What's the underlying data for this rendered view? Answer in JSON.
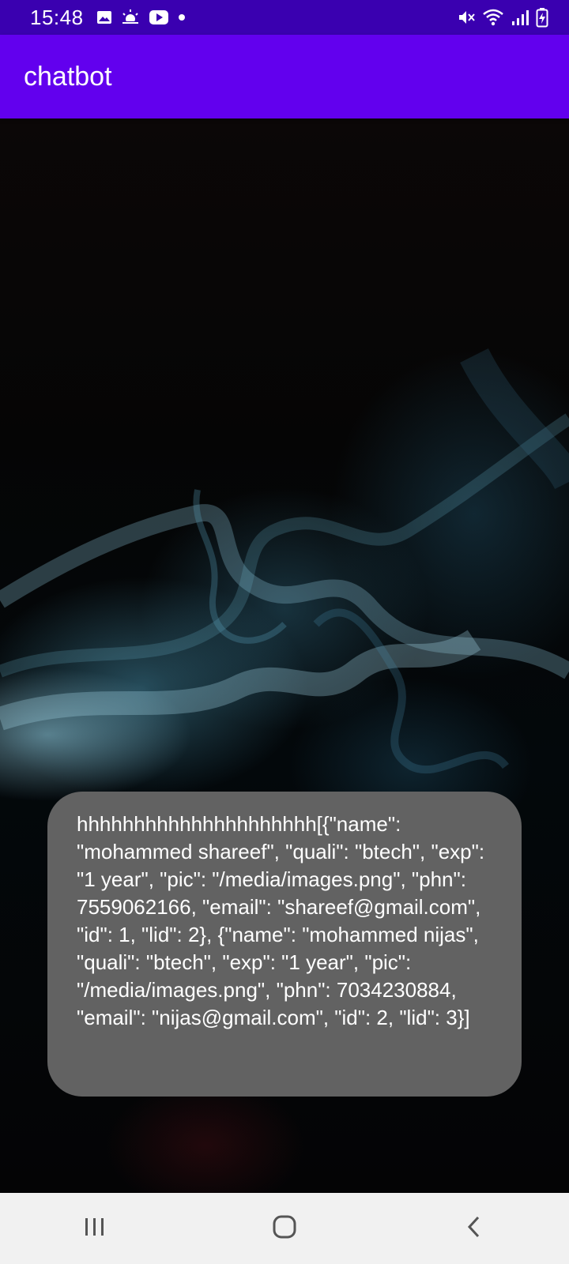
{
  "status_bar": {
    "time": "15:48",
    "left_icons": [
      "gallery-icon",
      "weather-icon",
      "youtube-icon",
      "notification-dot-icon"
    ],
    "right_icons": [
      "mute-icon",
      "wifi-icon",
      "signal-icon",
      "battery-charging-icon"
    ]
  },
  "app_bar": {
    "title": "chatbot",
    "color": "#6200ee"
  },
  "chat": {
    "messages": [
      {
        "text": "hhhhhhhhhhhhhhhhhhhhh[{\"name\": \"mohammed shareef\", \"quali\": \"btech\", \"exp\": \"1 year\", \"pic\": \"/media/images.png\", \"phn\": 7559062166, \"email\": \"shareef@gmail.com\", \"id\": 1, \"lid\": 2}, {\"name\": \"mohammed nijas\", \"quali\": \"btech\", \"exp\": \"1 year\", \"pic\": \"/media/images.png\", \"phn\": 7034230884, \"email\": \"nijas@gmail.com\", \"id\": 2, \"lid\": 3}]"
      }
    ]
  },
  "nav_bar": {
    "buttons": [
      "recent-apps-icon",
      "home-icon",
      "back-icon"
    ]
  }
}
